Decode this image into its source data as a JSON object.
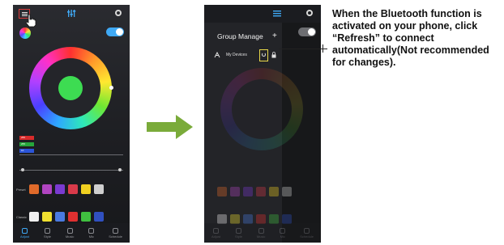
{
  "left_phone": {
    "rgb_values": [
      "255",
      "255",
      "10"
    ],
    "rows": [
      {
        "label": "Preset",
        "swatches": [
          "#e06a2a",
          "#b044c0",
          "#7a3ad0",
          "#d93a4a",
          "#f0d020",
          "#cfcfcf"
        ]
      },
      {
        "label": "Classic",
        "swatches": [
          "#f0f0f0",
          "#f0e030",
          "#4a7ae0",
          "#e03030",
          "#40c040",
          "#3050c0"
        ]
      }
    ],
    "nav": [
      {
        "label": "Adjust",
        "active": true
      },
      {
        "label": "Style",
        "active": false
      },
      {
        "label": "Music",
        "active": false
      },
      {
        "label": "Mic",
        "active": false
      },
      {
        "label": "Schedule",
        "active": false
      }
    ]
  },
  "right_phone": {
    "group_title": "Group Manage",
    "add_symbol": "+",
    "device_label": "My Devices",
    "nav": [
      {
        "label": "Adjust",
        "active": false
      },
      {
        "label": "Style",
        "active": false
      },
      {
        "label": "Music",
        "active": false
      },
      {
        "label": "Mic",
        "active": false
      },
      {
        "label": "Schedule",
        "active": false
      }
    ]
  },
  "annotation": {
    "text": "When the Bluetooth function is activated on your phone, click “Refresh” to connect automatically(Not recommended for changes)."
  },
  "colors": {
    "accent": "#3fa9f5",
    "arrow": "#7aab3a",
    "highlight_red": "#d93a3a",
    "highlight_yellow": "#e8d84a"
  }
}
